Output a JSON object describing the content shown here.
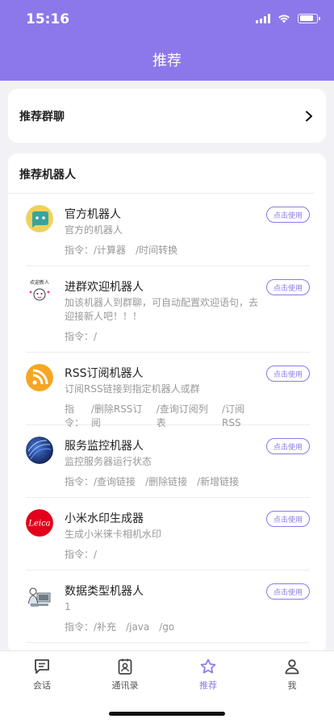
{
  "status": {
    "time": "15:16",
    "battery_level": 0.8
  },
  "nav": {
    "title": "推荐"
  },
  "groups": {
    "title": "推荐群聊"
  },
  "bots": {
    "title": "推荐机器人",
    "use_label": "点击使用",
    "items": [
      {
        "name": "官方机器人",
        "desc": "官方的机器人",
        "cmd_prefix": "指令：",
        "cmds": [
          "/计算器",
          "/时间转换"
        ],
        "icon": "official-bot-icon"
      },
      {
        "name": "进群欢迎机器人",
        "desc": "加该机器人到群聊，可自动配置欢迎语句，去迎接新人吧！！！",
        "cmd_prefix": "指令：",
        "cmds": [
          "/"
        ],
        "icon": "welcome-bot-icon",
        "avatar_text": "欢迎新人"
      },
      {
        "name": "RSS订阅机器人",
        "desc": "订阅RSS链接到指定机器人或群",
        "cmd_prefix": "指令：",
        "cmds": [
          "/删除RSS订阅",
          "/查询订阅列表",
          "/订阅RSS"
        ],
        "icon": "rss-icon"
      },
      {
        "name": "服务监控机器人",
        "desc": "监控服务器运行状态",
        "cmd_prefix": "指令：",
        "cmds": [
          "/查询链接",
          "/删除链接",
          "/新增链接"
        ],
        "icon": "monitor-bot-icon"
      },
      {
        "name": "小米水印生成器",
        "desc": "生成小米徕卡相机水印",
        "cmd_prefix": "指令：",
        "cmds": [
          "/"
        ],
        "icon": "leica-icon",
        "avatar_text": "Leica"
      },
      {
        "name": "数据类型机器人",
        "desc": "1",
        "cmd_prefix": "指令：",
        "cmds": [
          "/补充",
          "/java",
          "/go"
        ],
        "icon": "data-type-bot-icon"
      }
    ]
  },
  "tabs": [
    {
      "label": "会话",
      "icon": "chat-icon"
    },
    {
      "label": "通讯录",
      "icon": "contacts-icon"
    },
    {
      "label": "推荐",
      "icon": "star-icon"
    },
    {
      "label": "我",
      "icon": "user-icon"
    }
  ],
  "colors": {
    "accent": "#8c78ea"
  }
}
